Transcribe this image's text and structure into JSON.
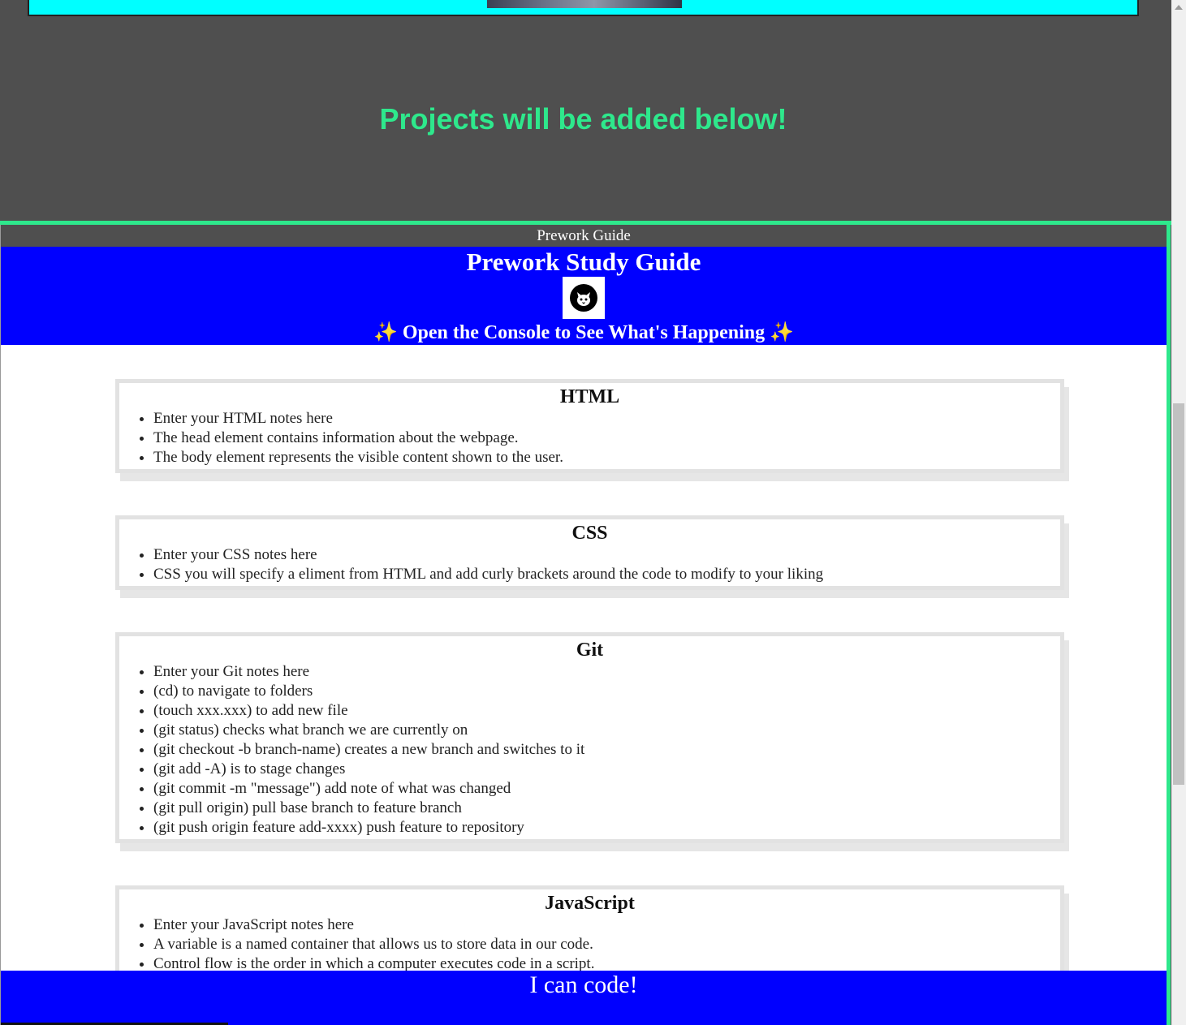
{
  "projects_heading": "Projects will be added below!",
  "frame_caption": "Prework Guide",
  "guide": {
    "title": "Prework Study Guide",
    "logo_icon": "cat-icon",
    "subtitle_sparkle": "✨",
    "subtitle": "Open the Console to See What's Happening",
    "footer": "I can code!"
  },
  "cards": [
    {
      "title": "HTML",
      "items": [
        "Enter your HTML notes here",
        "The head element contains information about the webpage.",
        "The body element represents the visible content shown to the user."
      ]
    },
    {
      "title": "CSS",
      "items": [
        "Enter your CSS notes here",
        "CSS you will specify a eliment from HTML and add curly brackets around the code to modify to your liking"
      ]
    },
    {
      "title": "Git",
      "items": [
        "Enter your Git notes here",
        "(cd) to navigate to folders",
        "(touch xxx.xxx) to add new file",
        "(git status) checks what branch we are currently on",
        "(git checkout -b branch-name) creates a new branch and switches to it",
        "(git add -A) is to stage changes",
        "(git commit -m \"message\") add note of what was changed",
        "(git pull origin) pull base branch to feature branch",
        "(git push origin feature add-xxxx) push feature to repository"
      ]
    },
    {
      "title": "JavaScript",
      "items": [
        "Enter your JavaScript notes here",
        "A variable is a named container that allows us to store data in our code.",
        "Control flow is the order in which a computer executes code in a script."
      ]
    }
  ],
  "colors": {
    "accent_green": "#2ee88c",
    "header_blue": "#0000ff",
    "banner_cyan": "#00ffff",
    "page_gray": "#4f4f4f"
  }
}
